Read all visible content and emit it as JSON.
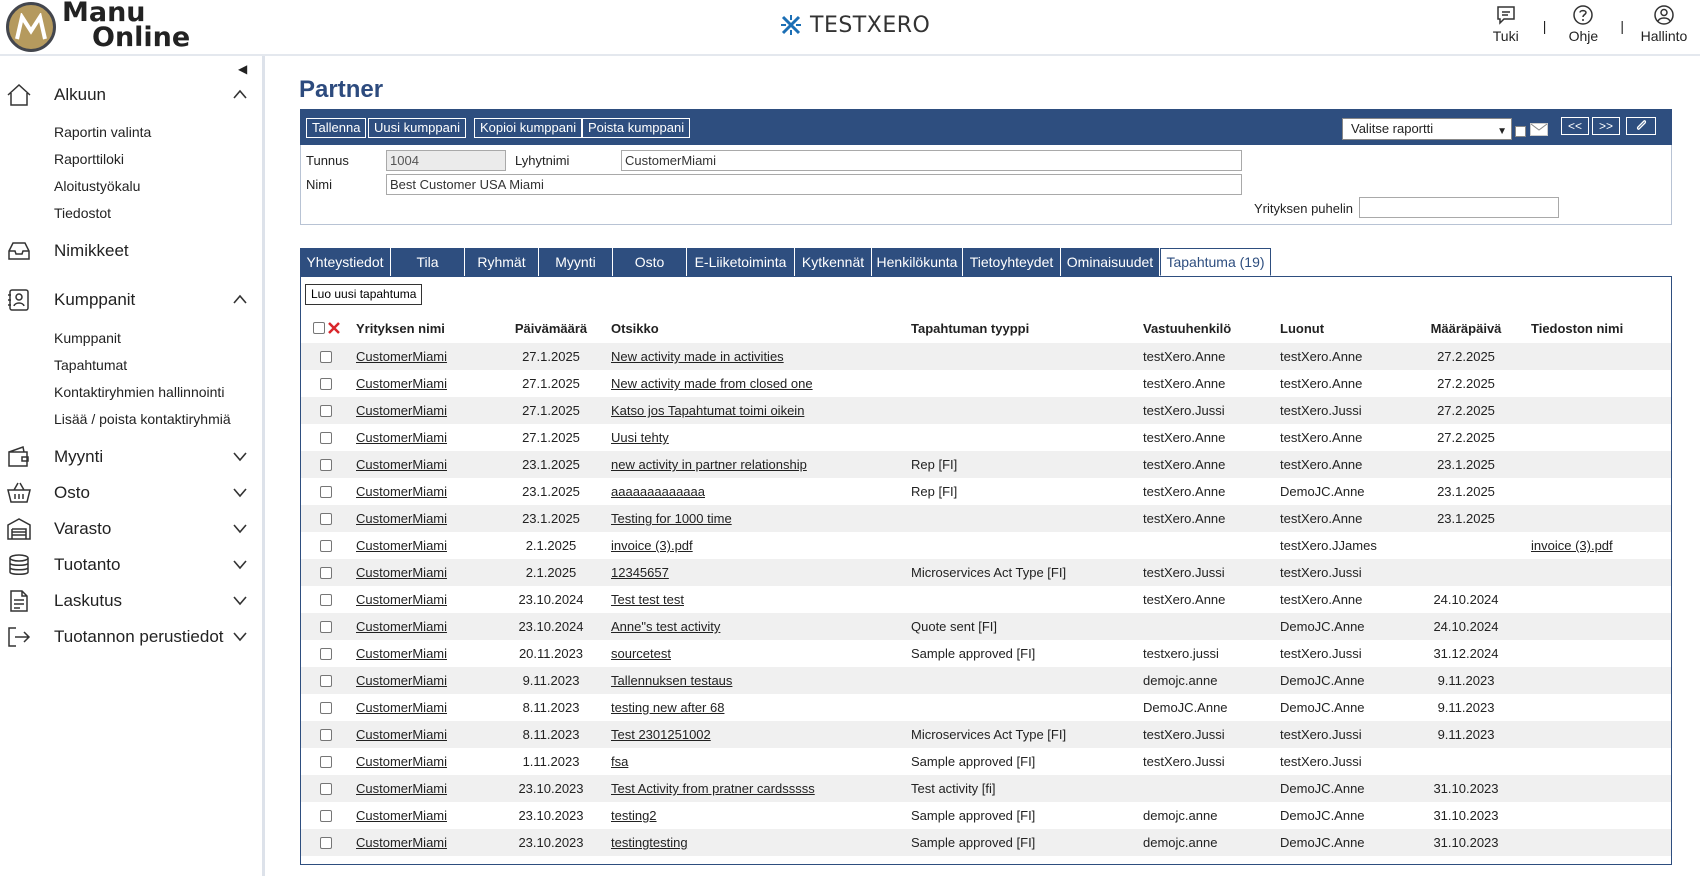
{
  "header": {
    "logo_line1": "Manu",
    "logo_line2": "Online",
    "brand": "TESTXERO",
    "buttons": [
      {
        "label": "Tuki",
        "icon": "chat-icon"
      },
      {
        "label": "Ohje",
        "icon": "help-icon"
      },
      {
        "label": "Hallinto",
        "icon": "user-icon"
      }
    ],
    "separator": "|"
  },
  "sidebar": {
    "sections": [
      {
        "label": "Alkuun",
        "icon": "home-icon",
        "expanded": true,
        "items": [
          "Raportin valinta",
          "Raporttiloki",
          "Aloitustyökalu",
          "Tiedostot"
        ]
      },
      {
        "label": "Nimikkeet",
        "icon": "inbox-icon"
      },
      {
        "label": "Kumppanit",
        "icon": "contacts-icon",
        "expanded": true,
        "items": [
          "Kumppanit",
          "Tapahtumat",
          "Kontaktiryhmien hallinnointi",
          "Lisää / poista kontaktiryhmiä"
        ]
      },
      {
        "label": "Myynti",
        "icon": "wallet-icon"
      },
      {
        "label": "Osto",
        "icon": "basket-icon"
      },
      {
        "label": "Varasto",
        "icon": "warehouse-icon"
      },
      {
        "label": "Tuotanto",
        "icon": "database-icon"
      },
      {
        "label": "Laskutus",
        "icon": "invoice-icon"
      },
      {
        "label": "Tuotannon perustiedot",
        "icon": "export-icon"
      }
    ]
  },
  "page": {
    "title": "Partner",
    "toolbar": {
      "save": "Tallenna",
      "new_partner": "Uusi kumppani",
      "copy_partner": "Kopioi kumppani",
      "delete_partner": "Poista kumppani",
      "report_select": "Valitse raportti",
      "prev": "<<",
      "next": ">>"
    },
    "form": {
      "id_label": "Tunnus",
      "id_value": "1004",
      "short_label": "Lyhytnimi",
      "short_value": "CustomerMiami",
      "name_label": "Nimi",
      "name_value": "Best Customer USA Miami",
      "phone_label": "Yrityksen puhelin",
      "phone_value": ""
    },
    "tabs": [
      "Yhteystiedot",
      "Tila",
      "Ryhmät",
      "Myynti",
      "Osto",
      "E-Liiketoiminta",
      "Kytkennät",
      "Henkilökunta",
      "Tietoyhteydet",
      "Ominaisuudet",
      "Tapahtuma (19)"
    ],
    "active_tab": "Tapahtuma (19)",
    "new_activity": "Luo uusi tapahtuma",
    "columns": [
      "Yrityksen nimi",
      "Päivämäärä",
      "Otsikko",
      "Tapahtuman tyyppi",
      "Vastuuhenkilö",
      "Luonut",
      "Määräpäivä",
      "Tiedoston nimi"
    ],
    "rows": [
      [
        "CustomerMiami",
        "27.1.2025",
        "New activity made in activities",
        "",
        "testXero.Anne",
        "testXero.Anne",
        "27.2.2025",
        ""
      ],
      [
        "CustomerMiami",
        "27.1.2025",
        "New activity made from closed one",
        "",
        "testXero.Anne",
        "testXero.Anne",
        "27.2.2025",
        ""
      ],
      [
        "CustomerMiami",
        "27.1.2025",
        "Katso jos Tapahtumat toimi oikein",
        "",
        "testXero.Jussi",
        "testXero.Jussi",
        "27.2.2025",
        ""
      ],
      [
        "CustomerMiami",
        "27.1.2025",
        "Uusi tehty",
        "",
        "testXero.Anne",
        "testXero.Anne",
        "27.2.2025",
        ""
      ],
      [
        "CustomerMiami",
        "23.1.2025",
        "new activity in partner relationship",
        "Rep [FI]",
        "testXero.Anne",
        "testXero.Anne",
        "23.1.2025",
        ""
      ],
      [
        "CustomerMiami",
        "23.1.2025",
        "aaaaaaaaaaaaa",
        "Rep [FI]",
        "testXero.Anne",
        "DemoJC.Anne",
        "23.1.2025",
        ""
      ],
      [
        "CustomerMiami",
        "23.1.2025",
        "Testing for 1000 time",
        "",
        "testXero.Anne",
        "testXero.Anne",
        "23.1.2025",
        ""
      ],
      [
        "CustomerMiami",
        "2.1.2025",
        "invoice (3).pdf",
        "",
        "",
        "testXero.JJames",
        "",
        "invoice (3).pdf"
      ],
      [
        "CustomerMiami",
        "2.1.2025",
        "12345657",
        "Microservices Act Type [FI]",
        "testXero.Jussi",
        "testXero.Jussi",
        "",
        ""
      ],
      [
        "CustomerMiami",
        "23.10.2024",
        "Test test test",
        "",
        "testXero.Anne",
        "testXero.Anne",
        "24.10.2024",
        ""
      ],
      [
        "CustomerMiami",
        "23.10.2024",
        "Anne\"s test activity",
        "Quote sent [FI]",
        "",
        "DemoJC.Anne",
        "24.10.2024",
        ""
      ],
      [
        "CustomerMiami",
        "20.11.2023",
        "sourcetest",
        "Sample approved [FI]",
        "testxero.jussi",
        "testXero.Jussi",
        "31.12.2024",
        ""
      ],
      [
        "CustomerMiami",
        "9.11.2023",
        "Tallennuksen testaus",
        "",
        "demojc.anne",
        "DemoJC.Anne",
        "9.11.2023",
        ""
      ],
      [
        "CustomerMiami",
        "8.11.2023",
        "testing new after 68",
        "",
        "DemoJC.Anne",
        "DemoJC.Anne",
        "9.11.2023",
        ""
      ],
      [
        "CustomerMiami",
        "8.11.2023",
        "Test 2301251002",
        "Microservices Act Type [FI]",
        "testXero.Jussi",
        "testXero.Jussi",
        "9.11.2023",
        ""
      ],
      [
        "CustomerMiami",
        "1.11.2023",
        "fsa",
        "Sample approved [FI]",
        "testXero.Jussi",
        "testXero.Jussi",
        "",
        ""
      ],
      [
        "CustomerMiami",
        "23.10.2023",
        "Test Activity from pratner cardsssss",
        "Test activity [fi]",
        "",
        "DemoJC.Anne",
        "31.10.2023",
        ""
      ],
      [
        "CustomerMiami",
        "23.10.2023",
        "testing2",
        "Sample approved [FI]",
        "demojc.anne",
        "DemoJC.Anne",
        "31.10.2023",
        ""
      ],
      [
        "CustomerMiami",
        "23.10.2023",
        "testingtesting",
        "Sample approved [FI]",
        "demojc.anne",
        "DemoJC.Anne",
        "31.10.2023",
        ""
      ]
    ]
  },
  "colors": {
    "primary": "#2e4e7f",
    "title": "#2d4b7e",
    "brand_icon": "#1c6fb5",
    "delete_x": "#d9262b",
    "row_alt": "#f0f0f0"
  }
}
